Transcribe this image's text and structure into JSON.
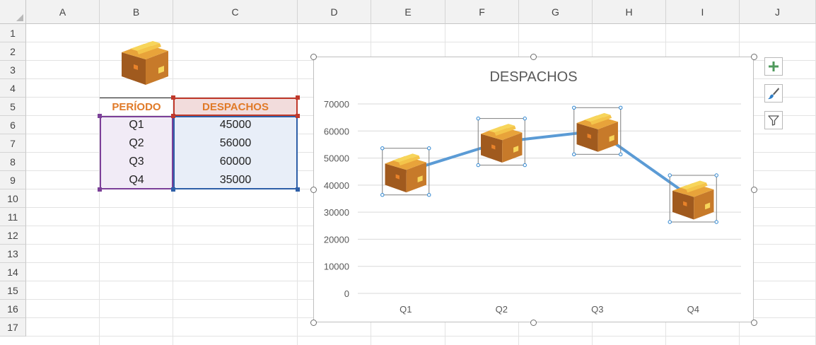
{
  "sheet": {
    "columns": [
      "A",
      "B",
      "C",
      "D",
      "E",
      "F",
      "G",
      "H",
      "I",
      "J"
    ],
    "rows": [
      "1",
      "2",
      "3",
      "4",
      "5",
      "6",
      "7",
      "8",
      "9",
      "10",
      "11",
      "12",
      "13",
      "14",
      "15",
      "16",
      "17"
    ]
  },
  "table": {
    "headers": {
      "period": "PERÍODO",
      "dispatches": "DESPACHOS"
    },
    "rows": [
      {
        "period": "Q1",
        "value": "45000"
      },
      {
        "period": "Q2",
        "value": "56000"
      },
      {
        "period": "Q3",
        "value": "60000"
      },
      {
        "period": "Q4",
        "value": "35000"
      }
    ]
  },
  "colors": {
    "header_text": "#e07a28",
    "period_fill": "#f1ebf6",
    "value_fill": "#e8eef8",
    "value_header_fill": "#f2dcdc",
    "period_border": "#7b3f98",
    "value_border": "#2e5fa8",
    "value_header_border": "#c0392b",
    "series_line": "#5b9bd5",
    "gridline": "#d9d9d9",
    "axis_text": "#595959",
    "box_front": "#a05a1e",
    "box_side": "#c77a2a",
    "box_top": "#e8a33a",
    "box_tape": "#f7d55a"
  },
  "chart_data": {
    "type": "line",
    "title": "DESPACHOS",
    "categories": [
      "Q1",
      "Q2",
      "Q3",
      "Q4"
    ],
    "series": [
      {
        "values": [
          45000,
          56000,
          60000,
          35000
        ]
      }
    ],
    "ylim": [
      0,
      70000
    ],
    "yticks": [
      "0",
      "10000",
      "20000",
      "30000",
      "40000",
      "50000",
      "60000",
      "70000"
    ],
    "grid": true,
    "legend": "none",
    "marker": "box-icon"
  },
  "chart_tools": {
    "add_element": "plus-icon",
    "style": "brush-icon",
    "filter": "filter-icon"
  },
  "icons": {
    "sheet_picture": "box-icon"
  }
}
